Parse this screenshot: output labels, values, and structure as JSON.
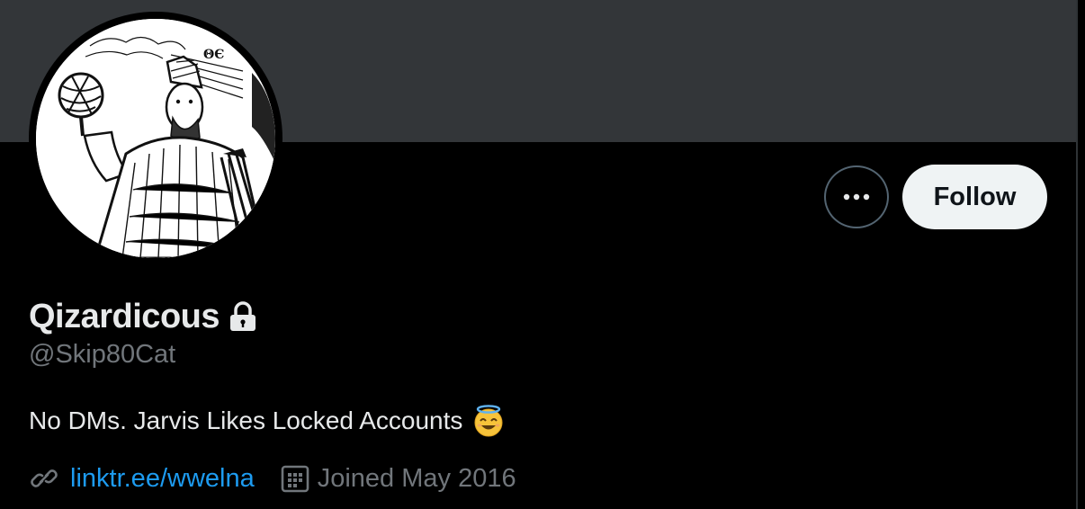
{
  "profile": {
    "display_name": "Qizardicous",
    "handle": "@Skip80Cat",
    "bio": "No DMs. Jarvis Likes Locked Accounts",
    "website": "linktr.ee/wwelna",
    "joined": "Joined May 2016",
    "avatar_lettering": "ΘЄ"
  },
  "actions": {
    "follow_label": "Follow",
    "more_label": "•••"
  },
  "icons": {
    "lock": "lock-icon",
    "bio_emoji": "smiling-face-with-halo-icon",
    "link": "link-icon",
    "calendar": "calendar-icon",
    "more": "more-icon"
  },
  "colors": {
    "background": "#000000",
    "banner": "#333639",
    "text_primary": "#e7e9ea",
    "text_secondary": "#71767b",
    "link": "#1d9bf0",
    "follow_bg": "#eff3f4",
    "follow_text": "#0f1419"
  }
}
